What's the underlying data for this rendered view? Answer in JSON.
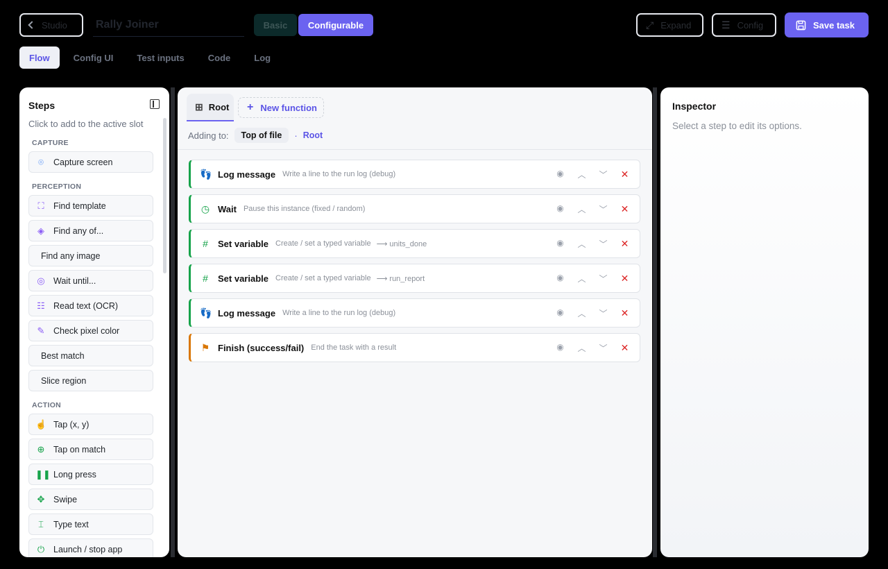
{
  "header": {
    "studio_label": "Studio",
    "task_title": "Rally Joiner",
    "mode_basic": "Basic",
    "mode_configurable": "Configurable",
    "expand_label": "Expand",
    "config_label": "Config",
    "save_label": "Save task"
  },
  "tabs": [
    {
      "label": "Flow",
      "active": true
    },
    {
      "label": "Config UI"
    },
    {
      "label": "Test inputs"
    },
    {
      "label": "Code"
    },
    {
      "label": "Log"
    }
  ],
  "steps_panel": {
    "title": "Steps",
    "subtitle": "Click to add to the active slot",
    "categories": [
      {
        "name": "CAPTURE",
        "items": [
          {
            "label": "Capture screen",
            "icon": "camera-icon"
          }
        ]
      },
      {
        "name": "PERCEPTION",
        "items": [
          {
            "label": "Find template",
            "icon": "scan-icon"
          },
          {
            "label": "Find any of...",
            "icon": "layers-icon"
          },
          {
            "label": "Find any image",
            "icon": ""
          },
          {
            "label": "Wait until...",
            "icon": "radar-icon"
          },
          {
            "label": "Read text (OCR)",
            "icon": "scan-text-icon"
          },
          {
            "label": "Check pixel color",
            "icon": "eyedropper-icon"
          },
          {
            "label": "Best match",
            "icon": ""
          },
          {
            "label": "Slice region",
            "icon": ""
          }
        ]
      },
      {
        "name": "ACTION",
        "items": [
          {
            "label": "Tap (x, y)",
            "icon": "pointer-icon"
          },
          {
            "label": "Tap on match",
            "icon": "crosshair-icon"
          },
          {
            "label": "Long press",
            "icon": "pause-icon"
          },
          {
            "label": "Swipe",
            "icon": "move-icon"
          },
          {
            "label": "Type text",
            "icon": "text-cursor-icon"
          },
          {
            "label": "Launch / stop app",
            "icon": "power-icon"
          }
        ]
      }
    ]
  },
  "flow": {
    "function_tabs": {
      "root": "Root",
      "new_function": "New function"
    },
    "adding_to_label": "Adding to:",
    "adding_to_target": "Top of file",
    "adding_to_scope": "Root",
    "steps": [
      {
        "name": "Log message",
        "desc": "Write a line to the run log (debug)",
        "var": "",
        "icon": "footprints-icon",
        "color": "#16a34a"
      },
      {
        "name": "Wait",
        "desc": "Pause this instance (fixed / random)",
        "var": "",
        "icon": "clock-icon",
        "color": "#16a34a"
      },
      {
        "name": "Set variable",
        "desc": "Create / set a typed variable",
        "var": "⟶ units_done",
        "icon": "hash-icon",
        "color": "#16a34a"
      },
      {
        "name": "Set variable",
        "desc": "Create / set a typed variable",
        "var": "⟶ run_report",
        "icon": "hash-icon",
        "color": "#16a34a"
      },
      {
        "name": "Log message",
        "desc": "Write a line to the run log (debug)",
        "var": "",
        "icon": "footprints-icon",
        "color": "#16a34a"
      },
      {
        "name": "Finish (success/fail)",
        "desc": "End the task with a result",
        "var": "",
        "icon": "flag-icon",
        "color": "#d97706"
      }
    ]
  },
  "inspector": {
    "title": "Inspector",
    "subtitle": "Select a step to edit its options."
  },
  "colors": {
    "accent": "#6b63f0",
    "success": "#16a34a",
    "warning": "#d97706",
    "danger": "#dc2626"
  }
}
